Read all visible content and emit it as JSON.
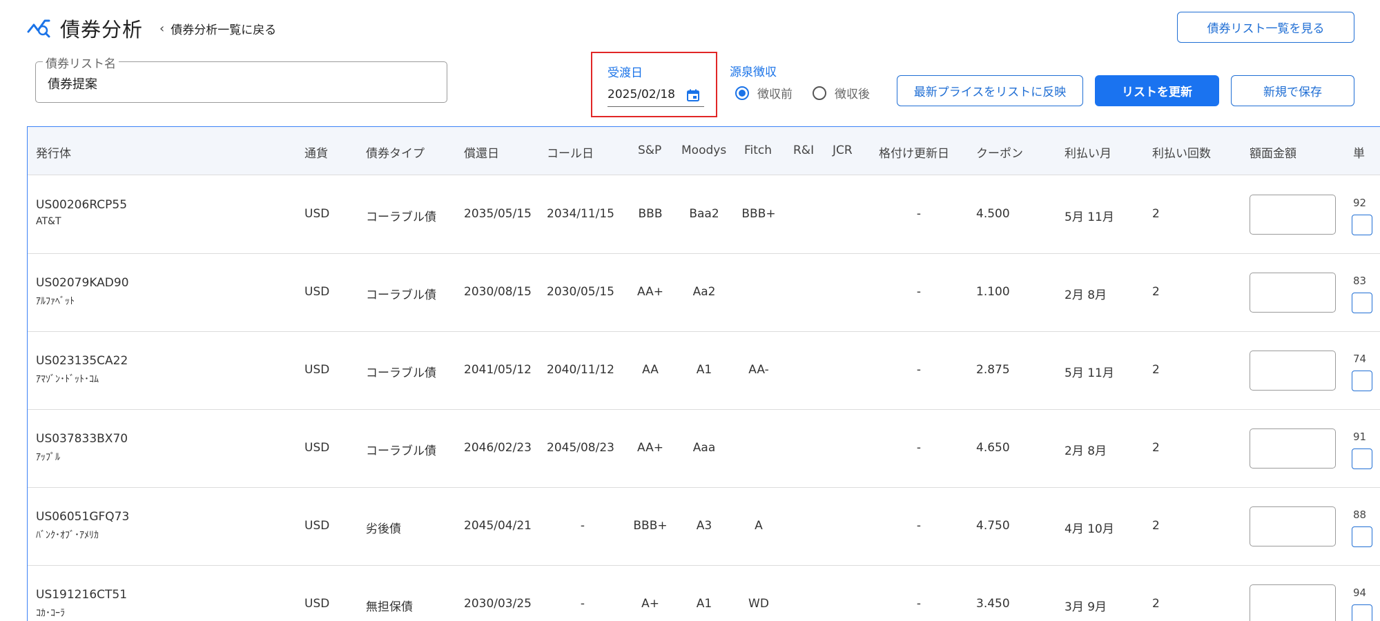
{
  "header": {
    "title": "債券分析",
    "back_label": "債券分析一覧に戻る",
    "view_list_button": "債券リスト一覧を見る"
  },
  "list_name": {
    "label": "債券リスト名",
    "value": "債券提案"
  },
  "settlement": {
    "label": "受渡日",
    "value": "2025/02/18"
  },
  "withholding": {
    "label": "源泉徴収",
    "options": [
      {
        "label": "徴収前",
        "selected": true
      },
      {
        "label": "徴収後",
        "selected": false
      }
    ]
  },
  "actions": {
    "reflect_price": "最新プライスをリストに反映",
    "update_list": "リストを更新",
    "save_new": "新規で保存"
  },
  "table": {
    "columns": [
      "発行体",
      "通貨",
      "債券タイプ",
      "償還日",
      "コール日",
      "S&P",
      "Moodys",
      "Fitch",
      "R&I",
      "JCR",
      "格付け更新日",
      "クーポン",
      "利払い月",
      "利払い回数",
      "額面金額",
      "単"
    ],
    "rows": [
      {
        "code": "US00206RCP55",
        "name": "AT&T",
        "currency": "USD",
        "type": "コーラブル債",
        "maturity": "2035/05/15",
        "call": "2034/11/15",
        "sp": "BBB",
        "moodys": "Baa2",
        "fitch": "BBB+",
        "ri": "",
        "jcr": "",
        "rating_date": "-",
        "coupon": "4.500",
        "pay_months": "5月 11月",
        "pay_count": "2",
        "unit_fragment": "92"
      },
      {
        "code": "US02079KAD90",
        "name": "ｱﾙﾌｧﾍﾞｯﾄ",
        "currency": "USD",
        "type": "コーラブル債",
        "maturity": "2030/08/15",
        "call": "2030/05/15",
        "sp": "AA+",
        "moodys": "Aa2",
        "fitch": "",
        "ri": "",
        "jcr": "",
        "rating_date": "-",
        "coupon": "1.100",
        "pay_months": "2月 8月",
        "pay_count": "2",
        "unit_fragment": "83"
      },
      {
        "code": "US023135CA22",
        "name": "ｱﾏｿﾞﾝ･ﾄﾞｯﾄ･ｺﾑ",
        "currency": "USD",
        "type": "コーラブル債",
        "maturity": "2041/05/12",
        "call": "2040/11/12",
        "sp": "AA",
        "moodys": "A1",
        "fitch": "AA-",
        "ri": "",
        "jcr": "",
        "rating_date": "-",
        "coupon": "2.875",
        "pay_months": "5月 11月",
        "pay_count": "2",
        "unit_fragment": "74"
      },
      {
        "code": "US037833BX70",
        "name": "ｱｯﾌﾟﾙ",
        "currency": "USD",
        "type": "コーラブル債",
        "maturity": "2046/02/23",
        "call": "2045/08/23",
        "sp": "AA+",
        "moodys": "Aaa",
        "fitch": "",
        "ri": "",
        "jcr": "",
        "rating_date": "-",
        "coupon": "4.650",
        "pay_months": "2月 8月",
        "pay_count": "2",
        "unit_fragment": "91"
      },
      {
        "code": "US06051GFQ73",
        "name": "ﾊﾞﾝｸ･ｵﾌﾞ･ｱﾒﾘｶ",
        "currency": "USD",
        "type": "劣後債",
        "maturity": "2045/04/21",
        "call": "-",
        "sp": "BBB+",
        "moodys": "A3",
        "fitch": "A",
        "ri": "",
        "jcr": "",
        "rating_date": "-",
        "coupon": "4.750",
        "pay_months": "4月 10月",
        "pay_count": "2",
        "unit_fragment": "88"
      },
      {
        "code": "US191216CT51",
        "name": "ｺｶ･ｺｰﾗ",
        "currency": "USD",
        "type": "無担保債",
        "maturity": "2030/03/25",
        "call": "-",
        "sp": "A+",
        "moodys": "A1",
        "fitch": "WD",
        "ri": "",
        "jcr": "",
        "rating_date": "-",
        "coupon": "3.450",
        "pay_months": "3月 9月",
        "pay_count": "2",
        "unit_fragment": "94"
      }
    ]
  },
  "colors": {
    "accent": "#1a73f0",
    "highlight_border": "#e12626",
    "header_bg": "#f3f6fb"
  }
}
